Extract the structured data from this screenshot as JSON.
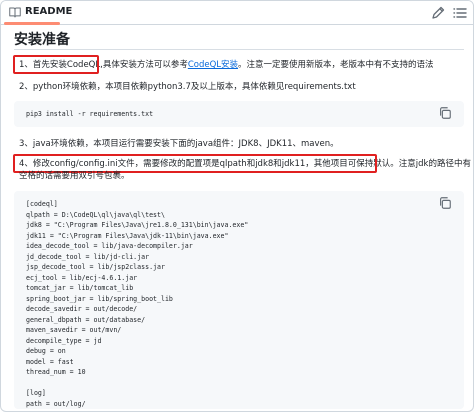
{
  "header": {
    "tab_label": "README"
  },
  "title": "安装准备",
  "step1": {
    "lead": "1、首先安装CodeQL,",
    "mid": "具体安装方法可以参考",
    "link": "CodeQL安装",
    "tail": "。注意一定要使用新版本，老版本中有不支持的语法"
  },
  "step2": {
    "text": "2、python环境依赖，本项目依赖python3.7及以上版本，具体依赖见requirements.txt"
  },
  "pip_command": "pip3 install -r requirements.txt",
  "step3": {
    "text": "3、java环境依赖，本项目运行需要安装下面的java组件：JDK8、JDK11、maven。"
  },
  "step4": {
    "lead": "4、修改config/config.ini文件，需要修改的配置项是qlpath和jdk8和jdk11，其他项目可保持默认。",
    "tail": "注意jdk的路径中有",
    "line2": "空格的话需要用双引号包裹。"
  },
  "config_lines": [
    "[codeql]",
    "qlpath = D:\\CodeQL\\ql\\java\\ql\\test\\",
    "jdk8 = \"C:\\Program Files\\Java\\jre1.8.0_131\\bin\\java.exe\"",
    "jdk11 = \"C:\\Program Files\\Java\\jdk-11\\bin\\java.exe\"",
    "idea_decode_tool = lib/java-decompiler.jar",
    "jd_decode_tool = lib/jd-cli.jar",
    "jsp_decode_tool = lib/jsp2class.jar",
    "ecj_tool = lib/ecj-4.6.1.jar",
    "tomcat_jar = lib/tomcat_lib",
    "spring_boot_jar = lib/spring_boot_lib",
    "decode_savedir = out/decode/",
    "general_dbpath = out/database/",
    "maven_savedir = out/mvn/",
    "decompile_type = jd",
    "debug = on",
    "model = fast",
    "thread_num = 10",
    "",
    "[log]",
    "path = out/log/"
  ],
  "colors": {
    "link": "#0969da",
    "highlight_box": "#e02020",
    "tab_underline": "#fd8c73",
    "code_bg": "#f6f8fa"
  },
  "icons": [
    "book-icon",
    "pencil-icon",
    "list-icon",
    "copy-icon"
  ]
}
